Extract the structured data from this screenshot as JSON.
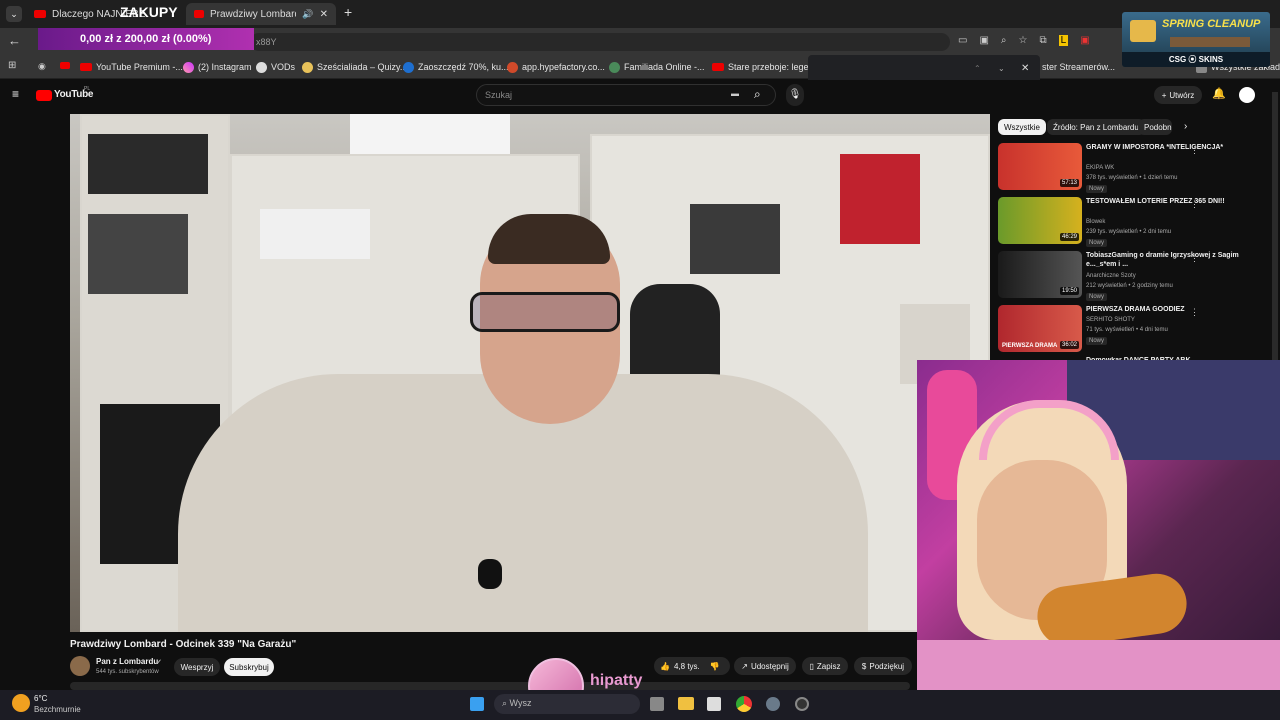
{
  "browser": {
    "tabs": [
      {
        "label": "Dlaczego NAJNIEBE"
      },
      {
        "label": "Prawdziwy Lombard - Odci"
      }
    ],
    "new_tab": "+",
    "address_text": "x88Y",
    "bookmarks": [
      {
        "label": "YouTube Premium -..."
      },
      {
        "label": "(2) Instagram"
      },
      {
        "label": "VODs"
      },
      {
        "label": "Sześcialiada – Quizy..."
      },
      {
        "label": "Zaoszczędź 70%, ku..."
      },
      {
        "label": "app.hypefactory.co..."
      },
      {
        "label": "Familiada Online -..."
      },
      {
        "label": "Stare przeboje: lege..."
      },
      {
        "label": "ster Streamerów..."
      },
      {
        "label": "Wszystkie zakładki"
      }
    ]
  },
  "stream_overlay": {
    "zakupy_title": "ZAKUPY",
    "zakupy_progress": "0,00 zł z 200,00 zł (0.00%)",
    "spring_title": "SPRING CLEANUP",
    "spring_brand": "CSG ⦿ SKINS",
    "streamer_name": "hipatty"
  },
  "youtube": {
    "logo_text": "YouTube",
    "region": "PL",
    "search_placeholder": "Szukaj",
    "create_label": "Utwórz",
    "video_title": "Prawdziwy Lombard - Odcinek 339 \"Na Garażu\"",
    "channel_name": "Pan z Lombardu",
    "subscribers": "544 tys. subskrybentów",
    "support_label": "Wesprzyj",
    "subscribe_label": "Subskrybuj",
    "likes": "4,8 tys.",
    "share_label": "Udostępnij",
    "save_label": "Zapisz",
    "thanks_label": "Podziękuj",
    "filter_chips": [
      "Wszystkie",
      "Źródło: Pan z Lombardu",
      "Podobne"
    ],
    "recommended": [
      {
        "title": "GRAMY W IMPOSTORA *INTELIGENCJA*",
        "channel": "EKIPA WK",
        "meta": "378 tys. wyświetleń • 1 dzień temu",
        "duration": "57:13",
        "badge": "Nowy",
        "color": "#c8322c"
      },
      {
        "title": "TESTOWAŁEM LOTERIE PRZEZ 365 DNI!!",
        "channel": "Blowek",
        "meta": "239 tys. wyświetleń • 2 dni temu",
        "duration": "46:29",
        "badge": "Nowy",
        "color": "#d6b11e"
      },
      {
        "title": "TobiaszGaming o dramie Igrzyskowej z Sagim e..._s*em i ...",
        "channel": "Anarchiczne Szoty",
        "meta": "212 wyświetleń • 2 godziny temu",
        "duration": "19:50",
        "badge": "Nowy",
        "color": "#2a2a2a"
      },
      {
        "title": "PIERWSZA DRAMA GOODIEZ",
        "channel": "SERHITO SHOTY",
        "meta": "71 tys. wyświetleń • 4 dni temu",
        "duration": "36:02",
        "badge": "Nowy",
        "color": "#b0272d"
      }
    ],
    "thumb_caption": "PIERWSZA DRAMA",
    "partial_next_title": "Domowkar DANCE PARTY ABK"
  },
  "taskbar": {
    "temperature": "6°C",
    "weather": "Bezchmurnie",
    "search_text": "Wysz"
  }
}
